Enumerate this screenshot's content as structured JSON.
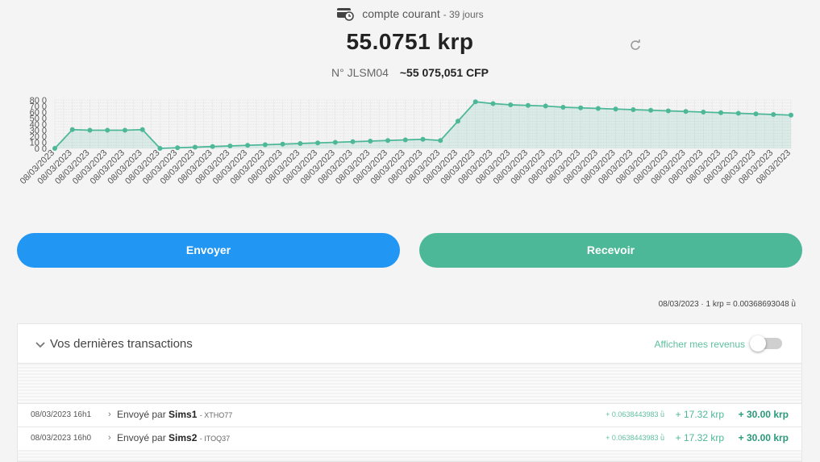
{
  "account": {
    "name": "compte courant",
    "age": "- 39 jours",
    "balance": "55.0751 krp",
    "number": "N° JLSM04",
    "cfp": "~55 075,051 CFP",
    "icon": "wallet-clock-icon"
  },
  "actions": {
    "send": "Envoyer",
    "receive": "Recevoir"
  },
  "rate": "08/03/2023 · 1 krp = 0.00368693048 ǜ",
  "transactions": {
    "title": "Vos dernières transactions",
    "toggle_label": "Afficher mes revenus",
    "toggle_on": false,
    "rows": [
      {
        "date": "08/03/2023 16h1",
        "prefix": "Envoyé par",
        "who": "Sims1",
        "code": "- XTHO77",
        "small": "+ 0.0638443983 ǜ",
        "mid": "+ 17.32 krp",
        "big": "+ 30.00 krp"
      },
      {
        "date": "08/03/2023 16h0",
        "prefix": "Envoyé par",
        "who": "Sims2",
        "code": "- ITOQ37",
        "small": "+ 0.0638443983 ǜ",
        "mid": "+ 17.32 krp",
        "big": "+ 30.00 krp"
      }
    ]
  },
  "colors": {
    "send": "#2196f3",
    "receive": "#4db898",
    "line": "#4db898"
  },
  "chart_data": {
    "type": "area",
    "x_label": "08/03/2023",
    "ylim": [
      0,
      80
    ],
    "y_ticks": [
      0,
      10,
      20,
      30,
      40,
      50,
      60,
      70,
      80
    ],
    "values": [
      0,
      31,
      30,
      30,
      30,
      31,
      0,
      1,
      2,
      3,
      4,
      5,
      6,
      7,
      8,
      9,
      10,
      11,
      12,
      13,
      14,
      15,
      13,
      45,
      77,
      74,
      72,
      71,
      70,
      68,
      67,
      66,
      65,
      64,
      63,
      62,
      61,
      60,
      59,
      58,
      57,
      56,
      55
    ]
  }
}
